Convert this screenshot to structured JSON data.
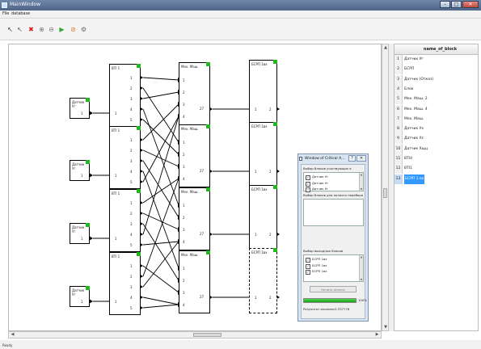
{
  "window": {
    "title": "MainWindow",
    "controls": {
      "minimize": "–",
      "maximize": "□",
      "close": "✕"
    }
  },
  "menu": [
    "File",
    "database"
  ],
  "toolbar": [
    {
      "name": "pointer-icon",
      "glyph": "↖",
      "color": "#3a3a3a"
    },
    {
      "name": "pointer-alt-icon",
      "glyph": "↖",
      "color": "#5a5a5a"
    },
    {
      "name": "delete-icon",
      "glyph": "✖",
      "color": "#d22020"
    },
    {
      "name": "zoom-in-icon",
      "glyph": "⊕",
      "color": "#7a7a7a"
    },
    {
      "name": "zoom-out-icon",
      "glyph": "⊖",
      "color": "#7a7a7a"
    },
    {
      "name": "run-icon",
      "glyph": "▶",
      "color": "#2fa82f"
    },
    {
      "name": "stop-icon",
      "glyph": "⊘",
      "color": "#e07820"
    },
    {
      "name": "settings-icon",
      "glyph": "⚙",
      "color": "#6a6a6a"
    }
  ],
  "diagram": {
    "sensor_label": "Датчик Уг",
    "sensor_out": "1",
    "bti_label": "BTI 1",
    "bti_inputs": [
      "1"
    ],
    "bti_outputs": [
      "1",
      "2",
      "3",
      "4",
      "5"
    ],
    "mek_label": "Мех. Маш.",
    "mek_inputs": [
      "1",
      "2",
      "3",
      "4"
    ],
    "mek_out": "27",
    "bsrp_label": "БСРП 1вх",
    "bsrp_inputs": [
      "1",
      "2"
    ],
    "rows": 4
  },
  "table": {
    "header": "name_of_block",
    "rows": [
      {
        "n": "1",
        "name": "Датчик Уг"
      },
      {
        "n": "2",
        "name": "БСРП"
      },
      {
        "n": "3",
        "name": "Датчик (Отказ)"
      },
      {
        "n": "4",
        "name": "Блок"
      },
      {
        "n": "5",
        "name": "Мех. Маш. 2"
      },
      {
        "n": "6",
        "name": "Мех. Маш. 4"
      },
      {
        "n": "7",
        "name": "Мех. Маш."
      },
      {
        "n": "8",
        "name": "Датчик Ух"
      },
      {
        "n": "9",
        "name": "Датчик Уz"
      },
      {
        "n": "10",
        "name": "Датчик Xщц"
      },
      {
        "n": "11",
        "name": "BTI4"
      },
      {
        "n": "12",
        "name": "BTI1"
      },
      {
        "n": "13",
        "name": "БСРП 1 вх",
        "selected": true
      }
    ]
  },
  "dialog": {
    "title": "Window of Critical A...",
    "help": "?",
    "close": "✕",
    "section1": "Выбор блоков участвующих в анализе",
    "list1": [
      "Датчик Уг",
      "Датчик Уг",
      "Датчик Уг"
    ],
    "section2": "Выбор блоков для полного перебора",
    "section3": "Выбор выходных блоков",
    "list3": [
      "БСРП 1вх",
      "БСРП 1вх",
      "БСРП 1вх"
    ],
    "button": "Начать анализ",
    "progress": 1.0,
    "progress_text": "100%",
    "result": "Результат анализа:0.337778"
  },
  "status": "Ready",
  "colors": {
    "accent_green": "#1fb81f",
    "selection": "#3399ff",
    "progress": "#2cba2c"
  }
}
